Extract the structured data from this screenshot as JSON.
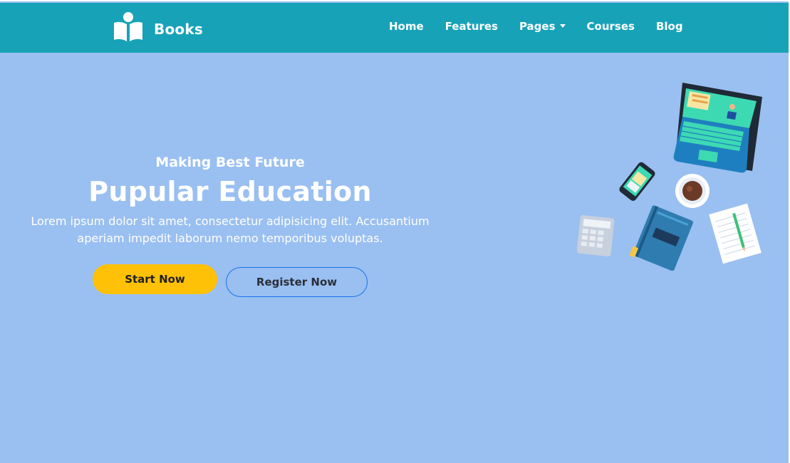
{
  "navbar": {
    "brand": {
      "icon": "book-reader-icon",
      "label": "Books"
    },
    "links": [
      {
        "label": "Home"
      },
      {
        "label": "Features"
      },
      {
        "label": "Pages",
        "dropdown": true
      },
      {
        "label": "Courses"
      },
      {
        "label": "Blog"
      }
    ]
  },
  "hero": {
    "subtitle": "Making Best Future",
    "title": "Pupular Education",
    "description": "Lorem ipsum dolor sit amet, consectetur adipisicing elit. Accusantium aperiam impedit laborum nemo temporibus voluptas.",
    "primary_button": "Start Now",
    "secondary_button": "Register Now"
  },
  "illustration": {
    "name": "desk-study-illustration",
    "items": [
      "laptop-icon",
      "phone-icon",
      "coffee-cup-icon",
      "calculator-icon",
      "notebook-icon",
      "paper-pencil-icon"
    ]
  },
  "colors": {
    "navbar": "#18a2b8",
    "background": "#9abff1",
    "primary_button": "#ffc107",
    "secondary_border": "#1a73e8"
  }
}
